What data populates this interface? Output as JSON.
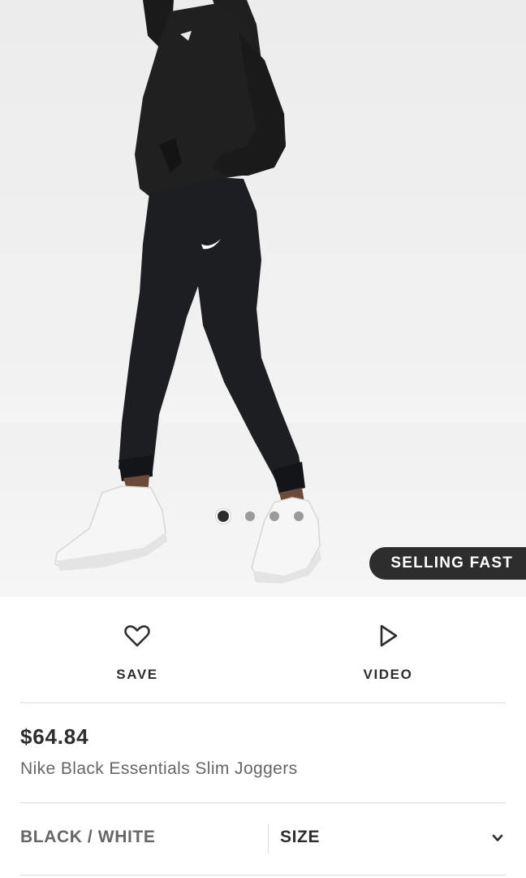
{
  "hero": {
    "image_name": "product-photo-model-black-joggers",
    "carousel": {
      "count": 4,
      "active_index": 0
    },
    "badge": "SELLING FAST"
  },
  "actions": {
    "save": {
      "label": "SAVE",
      "icon": "heart-icon"
    },
    "video": {
      "label": "VIDEO",
      "icon": "play-icon"
    }
  },
  "product": {
    "price": "$64.84",
    "name": "Nike Black Essentials Slim Joggers"
  },
  "options": {
    "color": "BLACK / WHITE",
    "size_label": "SIZE",
    "size_icon": "chevron-down-icon"
  },
  "colors": {
    "text_dark": "#2d2d2d",
    "text_muted": "#666666",
    "badge_bg": "#2d2d2d",
    "divider": "#dcdcdc"
  }
}
